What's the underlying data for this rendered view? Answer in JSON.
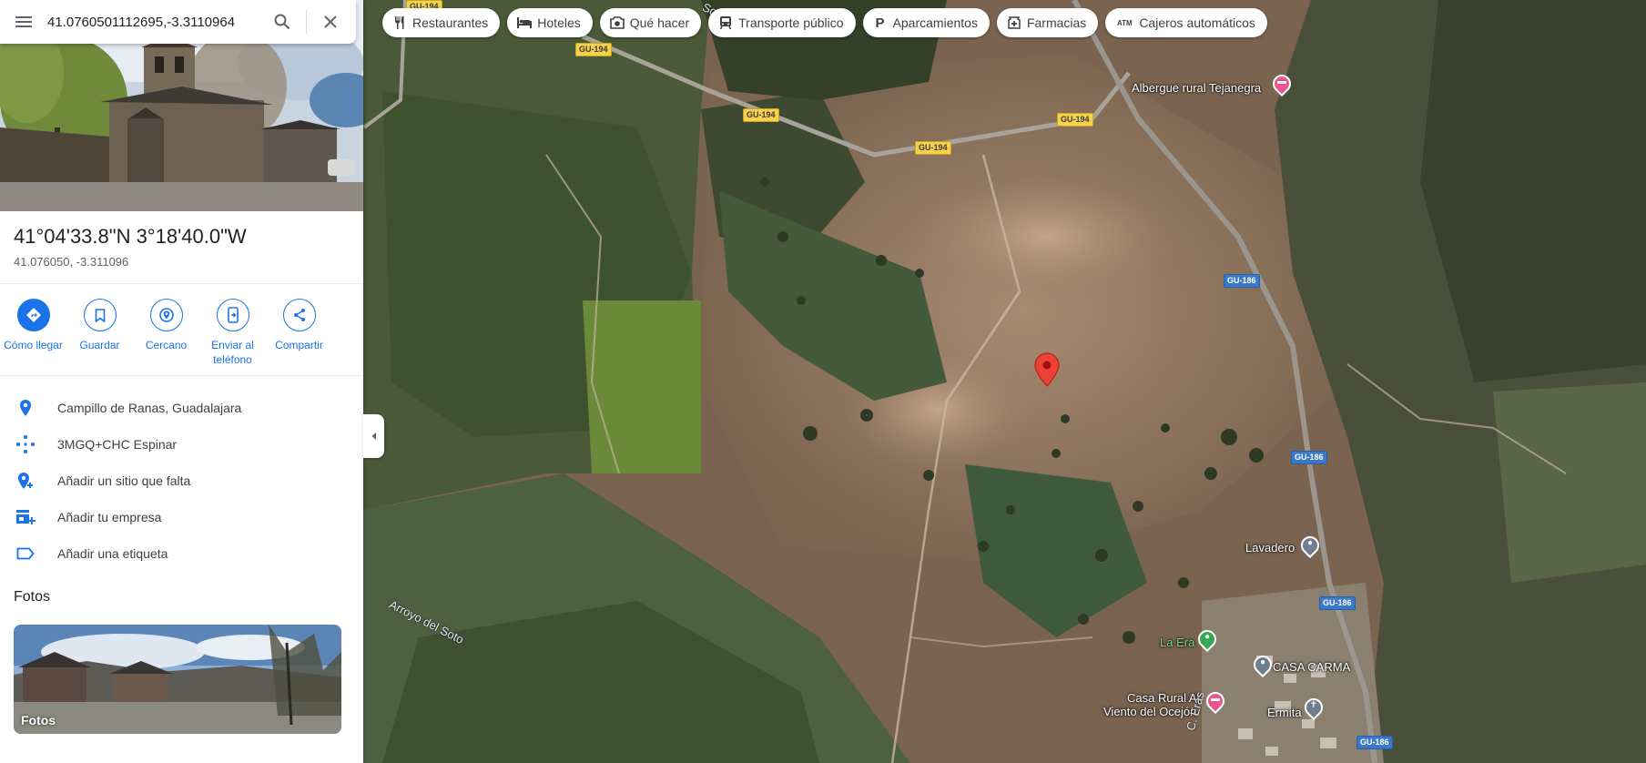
{
  "search": {
    "value": "41.0760501112695,-3.3110964"
  },
  "chips": [
    {
      "label": "Restaurantes",
      "icon": "fork-knife-icon"
    },
    {
      "label": "Hoteles",
      "icon": "bed-icon"
    },
    {
      "label": "Qué hacer",
      "icon": "camera-icon"
    },
    {
      "label": "Transporte público",
      "icon": "train-icon"
    },
    {
      "label": "Aparcamientos",
      "icon": "parking-icon"
    },
    {
      "label": "Farmacias",
      "icon": "pharmacy-icon"
    },
    {
      "label": "Cajeros automáticos",
      "icon": "atm-icon"
    }
  ],
  "place": {
    "title": "41°04'33.8\"N 3°18'40.0\"W",
    "decimal": "41.076050, -3.311096"
  },
  "actions": [
    {
      "label": "Cómo llegar",
      "icon": "directions-icon"
    },
    {
      "label": "Guardar",
      "icon": "bookmark-icon"
    },
    {
      "label": "Cercano",
      "icon": "nearby-icon"
    },
    {
      "label": "Enviar al teléfono",
      "icon": "phone-icon"
    },
    {
      "label": "Compartir",
      "icon": "share-icon"
    }
  ],
  "info": [
    {
      "text": "Campillo de Ranas, Guadalajara",
      "icon": "location-pin-icon"
    },
    {
      "text": "3MGQ+CHC Espinar",
      "icon": "plus-code-icon"
    },
    {
      "text": "Añadir un sitio que falta",
      "icon": "add-location-icon"
    },
    {
      "text": "Añadir tu empresa",
      "icon": "add-business-icon"
    },
    {
      "text": "Añadir una etiqueta",
      "icon": "label-icon"
    }
  ],
  "photos": {
    "heading": "Fotos",
    "card_label": "Fotos"
  },
  "map": {
    "roads": [
      "GU-194",
      "GU-194",
      "GU-194",
      "GU-194",
      "GU-186",
      "GU-186",
      "GU-186",
      "GU-186"
    ],
    "labels": {
      "albergue": "Albergue rural Tejanegra",
      "lavadero": "Lavadero",
      "la_era": "La Era",
      "casa_carma": "CASA CARMA",
      "casa_rural_1": "Casa Rural Al",
      "casa_rural_2": "Viento del Ocejón",
      "ermita": "Ermita",
      "arroyo": "Arroyo del Soto",
      "soto_top": "Soto",
      "eras": "C. Eras"
    }
  },
  "colors": {
    "accent": "#1a73e8",
    "pin_red": "#ea4335",
    "lodging_pink": "#e8578a",
    "park_green": "#34a853",
    "poi_gray": "#6f7f8f"
  }
}
